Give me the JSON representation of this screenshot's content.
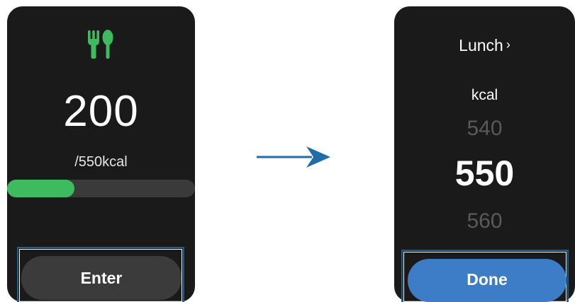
{
  "left_screen": {
    "icon": "fork-spoon-icon",
    "icon_color": "#3dbb5e",
    "value": "200",
    "target": "/550kcal",
    "progress_fraction": 0.36,
    "progress_color": "#3dbb5e",
    "button_label": "Enter"
  },
  "arrow": {
    "icon": "right-arrow-icon",
    "color": "#1f6da8"
  },
  "right_screen": {
    "meal": "Lunch",
    "meal_chevron": "›",
    "unit": "kcal",
    "picker_prev": "540",
    "picker_current": "550",
    "picker_next": "560",
    "button_label": "Done",
    "button_color": "#3d7cc7"
  }
}
